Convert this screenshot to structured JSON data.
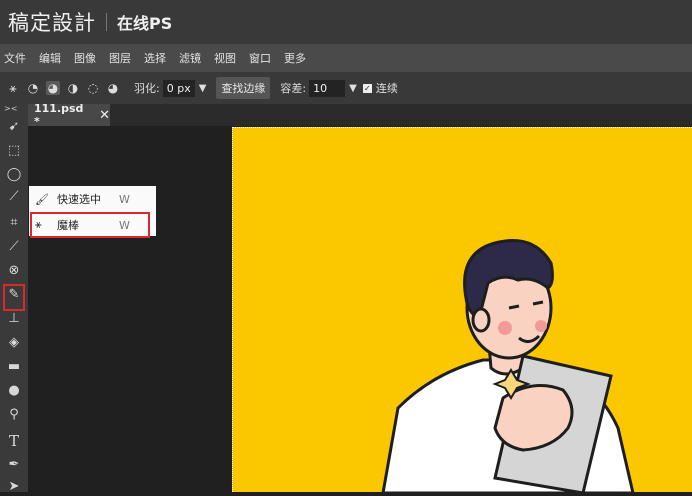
{
  "app": {
    "logo": "稿定設計",
    "subtitle": "在线PS"
  },
  "menu": [
    "文件",
    "编辑",
    "图像",
    "图层",
    "选择",
    "滤镜",
    "视图",
    "窗口",
    "更多"
  ],
  "options": {
    "feather_label": "羽化:",
    "feather_value": "0 px",
    "find_edge_button": "查找边缘",
    "tolerance_label": "容差:",
    "tolerance_value": "10",
    "contiguous_label": "连续"
  },
  "tab": {
    "title": "111.psd *"
  },
  "flyout": [
    {
      "label": "快速选中",
      "shortcut": "W"
    },
    {
      "label": "魔棒",
      "shortcut": "W"
    }
  ],
  "colors": {
    "highlight": "#d9292c",
    "canvas": "#fbc800"
  }
}
